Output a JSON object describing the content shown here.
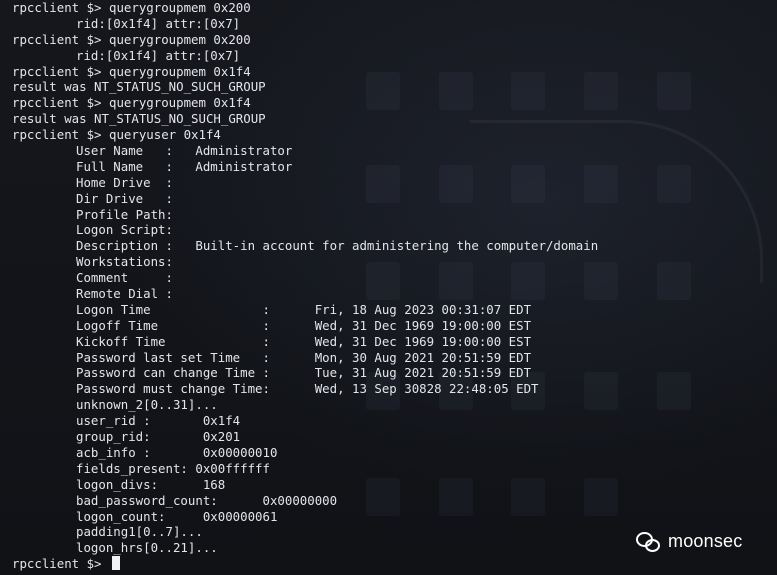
{
  "terminal": {
    "prompt": "rpcclient $>",
    "lines": [
      {
        "prompt": "rpcclient $>",
        "text": " querygroupmem 0x200"
      },
      {
        "indent": true,
        "text": "rid:[0x1f4] attr:[0x7]"
      },
      {
        "prompt": "rpcclient $>",
        "text": " querygroupmem 0x200"
      },
      {
        "indent": true,
        "text": "rid:[0x1f4] attr:[0x7]"
      },
      {
        "prompt": "rpcclient $>",
        "text": " querygroupmem 0x1f4"
      },
      {
        "text": "result was NT_STATUS_NO_SUCH_GROUP"
      },
      {
        "prompt": "rpcclient $>",
        "text": " querygroupmem 0x1f4"
      },
      {
        "text": "result was NT_STATUS_NO_SUCH_GROUP"
      },
      {
        "prompt": "rpcclient $>",
        "text": " queryuser 0x1f4"
      },
      {
        "indent": true,
        "text": "User Name   :   Administrator"
      },
      {
        "indent": true,
        "text": "Full Name   :   Administrator"
      },
      {
        "indent": true,
        "text": "Home Drive  :"
      },
      {
        "indent": true,
        "text": "Dir Drive   :"
      },
      {
        "indent": true,
        "text": "Profile Path:"
      },
      {
        "indent": true,
        "text": "Logon Script:"
      },
      {
        "indent": true,
        "text": "Description :   Built-in account for administering the computer/domain"
      },
      {
        "indent": true,
        "text": "Workstations:"
      },
      {
        "indent": true,
        "text": "Comment     :"
      },
      {
        "indent": true,
        "text": "Remote Dial :"
      },
      {
        "indent": true,
        "text": "Logon Time               :      Fri, 18 Aug 2023 00:31:07 EDT"
      },
      {
        "indent": true,
        "text": "Logoff Time              :      Wed, 31 Dec 1969 19:00:00 EST"
      },
      {
        "indent": true,
        "text": "Kickoff Time             :      Wed, 31 Dec 1969 19:00:00 EST"
      },
      {
        "indent": true,
        "text": "Password last set Time   :      Mon, 30 Aug 2021 20:51:59 EDT"
      },
      {
        "indent": true,
        "text": "Password can change Time :      Tue, 31 Aug 2021 20:51:59 EDT"
      },
      {
        "indent": true,
        "text": "Password must change Time:      Wed, 13 Sep 30828 22:48:05 EDT"
      },
      {
        "indent": true,
        "text": "unknown_2[0..31]..."
      },
      {
        "indent": true,
        "text": "user_rid :       0x1f4"
      },
      {
        "indent": true,
        "text": "group_rid:       0x201"
      },
      {
        "indent": true,
        "text": "acb_info :       0x00000010"
      },
      {
        "indent": true,
        "text": "fields_present: 0x00ffffff"
      },
      {
        "indent": true,
        "text": "logon_divs:      168"
      },
      {
        "indent": true,
        "text": "bad_password_count:      0x00000000"
      },
      {
        "indent": true,
        "text": "logon_count:     0x00000061"
      },
      {
        "indent": true,
        "text": "padding1[0..7]..."
      },
      {
        "indent": true,
        "text": "logon_hrs[0..21]..."
      },
      {
        "prompt": "rpcclient $>",
        "text": " ",
        "cursor": true
      }
    ]
  },
  "watermark": {
    "text": "moonsec",
    "icon": "wechat-icon"
  }
}
